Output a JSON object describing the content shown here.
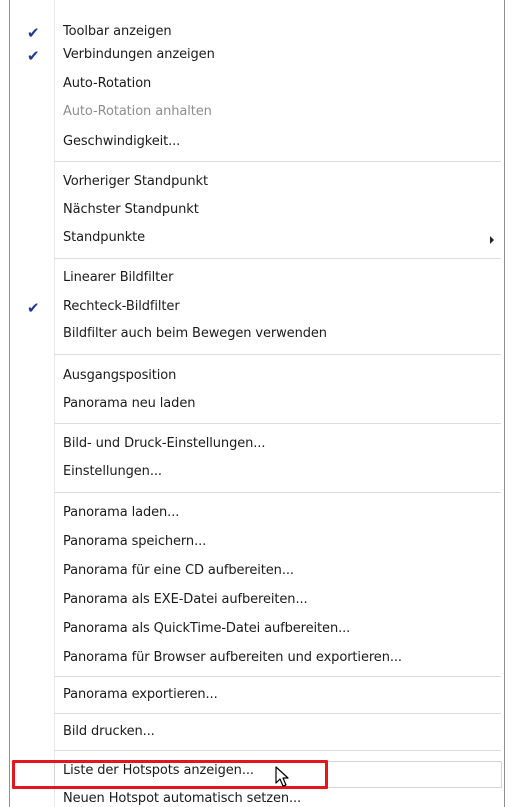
{
  "menu": {
    "items": [
      {
        "label": "Toolbar anzeigen",
        "checked": true,
        "enabled": true
      },
      {
        "label": "Verbindungen anzeigen",
        "checked": true,
        "enabled": true
      },
      {
        "label": "Auto-Rotation",
        "checked": false,
        "enabled": true
      },
      {
        "label": "Auto-Rotation anhalten",
        "checked": false,
        "enabled": false
      },
      {
        "label": "Geschwindigkeit...",
        "checked": false,
        "enabled": true
      },
      {
        "label": "Vorheriger Standpunkt",
        "checked": false,
        "enabled": true
      },
      {
        "label": "Nächster Standpunkt",
        "checked": false,
        "enabled": true
      },
      {
        "label": "Standpunkte",
        "checked": false,
        "enabled": true,
        "submenu": true
      },
      {
        "label": "Linearer Bildfilter",
        "checked": false,
        "enabled": true
      },
      {
        "label": "Rechteck-Bildfilter",
        "checked": true,
        "enabled": true
      },
      {
        "label": "Bildfilter auch beim Bewegen verwenden",
        "checked": false,
        "enabled": true
      },
      {
        "label": "Ausgangsposition",
        "checked": false,
        "enabled": true
      },
      {
        "label": "Panorama neu laden",
        "checked": false,
        "enabled": true
      },
      {
        "label": "Bild- und Druck-Einstellungen...",
        "checked": false,
        "enabled": true
      },
      {
        "label": "Einstellungen...",
        "checked": false,
        "enabled": true
      },
      {
        "label": "Panorama laden...",
        "checked": false,
        "enabled": true
      },
      {
        "label": "Panorama speichern...",
        "checked": false,
        "enabled": true
      },
      {
        "label": "Panorama für eine CD aufbereiten...",
        "checked": false,
        "enabled": true
      },
      {
        "label": "Panorama als EXE-Datei aufbereiten...",
        "checked": false,
        "enabled": true
      },
      {
        "label": "Panorama als QuickTime-Datei aufbereiten...",
        "checked": false,
        "enabled": true
      },
      {
        "label": "Panorama für Browser aufbereiten und exportieren...",
        "checked": false,
        "enabled": true
      },
      {
        "label": "Panorama exportieren...",
        "checked": false,
        "enabled": true
      },
      {
        "label": "Bild drucken...",
        "checked": false,
        "enabled": true
      },
      {
        "label": "Liste der Hotspots anzeigen...",
        "checked": false,
        "enabled": true,
        "hovered": true
      },
      {
        "label": "Neuen Hotspot automatisch setzen...",
        "checked": false,
        "enabled": true
      }
    ],
    "check_glyph": "✔",
    "colors": {
      "checkmark": "#1f3a8f",
      "disabled_text": "#8e8e8e",
      "highlight_box": "#e2161f"
    }
  }
}
